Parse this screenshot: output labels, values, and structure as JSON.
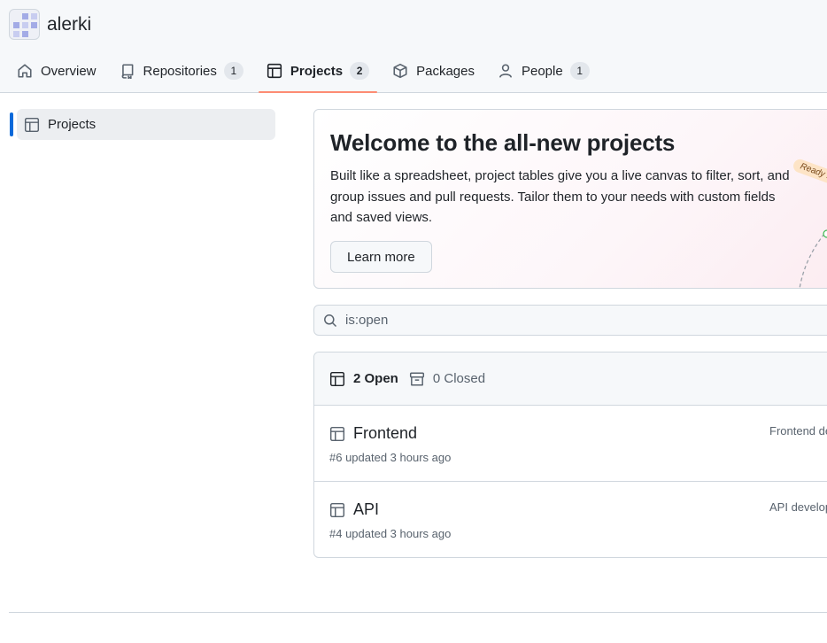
{
  "org": {
    "name": "alerki",
    "avatar_icon": "org-avatar"
  },
  "nav": {
    "tabs": [
      {
        "label": "Overview",
        "icon": "home-icon",
        "count": null
      },
      {
        "label": "Repositories",
        "icon": "repo-icon",
        "count": "1"
      },
      {
        "label": "Projects",
        "icon": "table-icon",
        "count": "2",
        "selected": true
      },
      {
        "label": "Packages",
        "icon": "package-icon",
        "count": null
      },
      {
        "label": "People",
        "icon": "person-icon",
        "count": "1"
      }
    ]
  },
  "sidebar": {
    "items": [
      {
        "label": "Projects",
        "icon": "table-icon",
        "selected": true
      }
    ]
  },
  "banner": {
    "title": "Welcome to the all-new projects",
    "body": "Built like a spreadsheet, project tables give you a live canvas to filter, sort, and group issues and pull requests. Tailor them to your needs with custom fields and saved views.",
    "button_label": "Learn more",
    "ready_tag": "Ready f"
  },
  "search": {
    "value": "is:open",
    "placeholder": ""
  },
  "list": {
    "open_label": "2 Open",
    "closed_label": "0 Closed",
    "projects": [
      {
        "title": "Frontend",
        "meta": "#6 updated 3 hours ago",
        "description": "Frontend de"
      },
      {
        "title": "API",
        "meta": "#4 updated 3 hours ago",
        "description": "API develop"
      }
    ]
  },
  "colors": {
    "accent_underline": "#fd8c73",
    "selected_bar": "#0969da",
    "border": "#d0d7de"
  }
}
